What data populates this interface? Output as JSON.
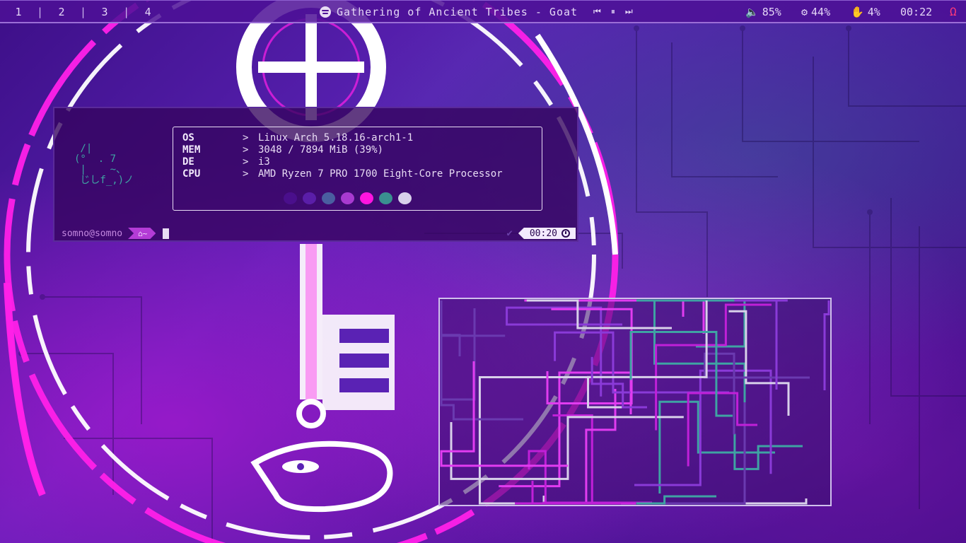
{
  "topbar": {
    "workspaces": [
      "1",
      "2",
      "3",
      "4"
    ],
    "separator": "|",
    "media": {
      "icon": "spotify-icon",
      "track": "Gathering of Ancient Tribes - Goat",
      "prev_icon": "skip-previous-icon",
      "pause_icon": "pause-icon",
      "next_icon": "skip-next-icon"
    },
    "volume": "85%",
    "cpu": "44%",
    "memory": "4%",
    "clock": "00:22",
    "power_glyph": "Ω"
  },
  "terminal": {
    "ascii_art": " ∕|\n(°  . 7\n |    ~、\n じしf_,)ノ",
    "info": [
      {
        "key": "OS",
        "arrow": ">",
        "value": "Linux Arch 5.18.16-arch1-1"
      },
      {
        "key": "MEM",
        "arrow": ">",
        "value": "3048 / 7894 MiB (39%)"
      },
      {
        "key": "DE",
        "arrow": ">",
        "value": "i3"
      },
      {
        "key": "CPU",
        "arrow": ">",
        "value": "AMD Ryzen 7 PRO 1700 Eight-Core Processor"
      }
    ],
    "palette": [
      "#4a0f8c",
      "#5a1ea8",
      "#4a5ea0",
      "#a83ad0",
      "#ff14e0",
      "#3a9090",
      "#d8d0ea"
    ],
    "prompt": {
      "user": "somno@somno",
      "dir": "~",
      "time": "00:20"
    }
  },
  "colors": {
    "accent": "#b43cd6",
    "teal": "#3fa3a3",
    "magenta": "#ff14e0"
  }
}
